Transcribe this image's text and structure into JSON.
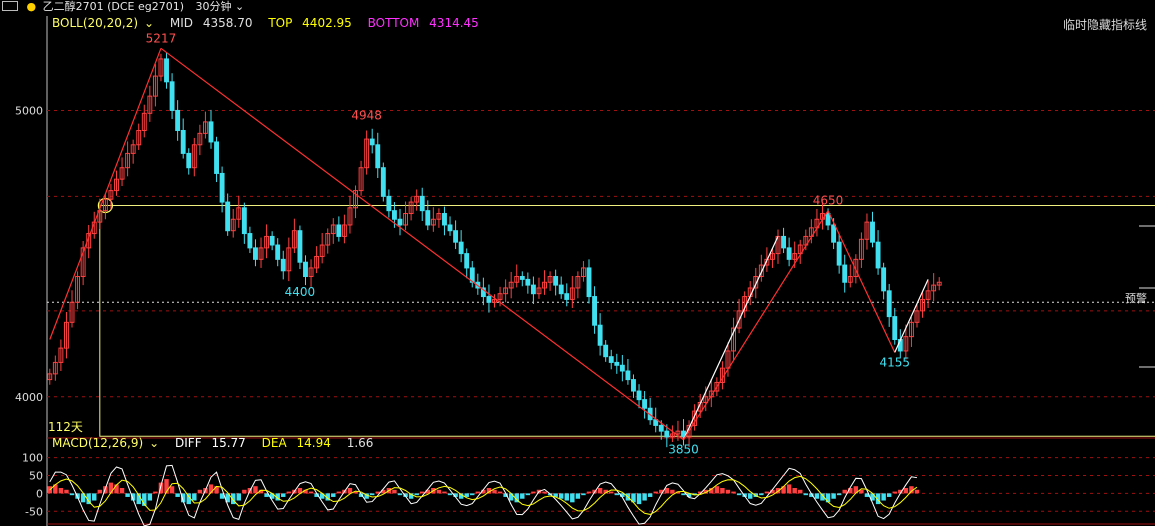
{
  "window": {
    "name": "乙二醇2701 (DCE eg2701)",
    "period": "30分钟"
  },
  "boll": {
    "label": "BOLL(20,20,2)",
    "mid_label": "MID",
    "mid": "4358.70",
    "top_label": "TOP",
    "top": "4402.95",
    "bottom_label": "BOTTOM",
    "bottom": "4314.45"
  },
  "hide_button": "临时隐藏指标线",
  "alert_label": "预警",
  "range_label": "112天",
  "macd": {
    "label": "MACD(12,26,9)",
    "diff_label": "DIFF",
    "diff": "15.77",
    "dea_label": "DEA",
    "dea": "14.94",
    "macd": "1.66"
  },
  "colors": {
    "up": "#ff4040",
    "down": "#40e0f0",
    "diff_line": "#ffffff",
    "dea_line": "#ffff00",
    "grid": "#a01010",
    "axis": "#c0c0c0"
  },
  "chart_data": {
    "type": "candlestick",
    "price_axis": {
      "ylim": [
        3870,
        5260
      ],
      "ticks": [
        "5000",
        "4000"
      ]
    },
    "macd_axis": {
      "ylim": [
        -80,
        110
      ],
      "ticks": [
        "100",
        "50",
        "0",
        "-50"
      ]
    },
    "annotations": [
      {
        "label": "5217",
        "index": 20,
        "price": 5217,
        "kind": "high"
      },
      {
        "label": "4948",
        "index": 57,
        "price": 4948,
        "kind": "high"
      },
      {
        "label": "4400",
        "index": 45,
        "price": 4400,
        "kind": "low"
      },
      {
        "label": "3850",
        "index": 114,
        "price": 3850,
        "kind": "low"
      },
      {
        "label": "4650",
        "index": 140,
        "price": 4650,
        "kind": "high"
      },
      {
        "label": "4155",
        "index": 152,
        "price": 4155,
        "kind": "low"
      }
    ],
    "alert_price": 4330,
    "box": {
      "top_price": 4668,
      "bottom_price": 3862,
      "from_index": 9
    },
    "trend_lines": [
      {
        "from": [
          0,
          4200
        ],
        "to": [
          20,
          5217
        ],
        "color": "#ff3030"
      },
      {
        "from": [
          20,
          5217
        ],
        "to": [
          114,
          3850
        ],
        "color": "#ff3030"
      },
      {
        "from": [
          114,
          3850
        ],
        "to": [
          131,
          4560
        ],
        "color": "#ffffff"
      },
      {
        "from": [
          114,
          3850
        ],
        "to": [
          140,
          4650
        ],
        "color": "#ff3030"
      },
      {
        "from": [
          140,
          4650
        ],
        "to": [
          152,
          4155
        ],
        "color": "#ff3030"
      },
      {
        "from": [
          152,
          4155
        ],
        "to": [
          158,
          4410
        ],
        "color": "#ffffff"
      }
    ],
    "closes": [
      4080,
      4120,
      4170,
      4260,
      4330,
      4420,
      4520,
      4570,
      4610,
      4650,
      4690,
      4720,
      4760,
      4800,
      4850,
      4880,
      4930,
      4990,
      5050,
      5120,
      5180,
      5100,
      5000,
      4930,
      4850,
      4800,
      4880,
      4920,
      4960,
      4890,
      4780,
      4680,
      4580,
      4620,
      4660,
      4570,
      4520,
      4480,
      4520,
      4560,
      4530,
      4480,
      4440,
      4520,
      4580,
      4470,
      4420,
      4450,
      4490,
      4530,
      4570,
      4600,
      4560,
      4600,
      4660,
      4720,
      4800,
      4900,
      4880,
      4800,
      4700,
      4650,
      4620,
      4600,
      4640,
      4680,
      4700,
      4650,
      4600,
      4620,
      4640,
      4600,
      4580,
      4540,
      4500,
      4450,
      4400,
      4380,
      4350,
      4330,
      4340,
      4360,
      4380,
      4400,
      4420,
      4410,
      4390,
      4360,
      4380,
      4400,
      4420,
      4390,
      4360,
      4340,
      4380,
      4420,
      4450,
      4350,
      4250,
      4180,
      4140,
      4120,
      4110,
      4090,
      4060,
      4020,
      3990,
      3960,
      3920,
      3900,
      3880,
      3860,
      3870,
      3880,
      3860,
      3900,
      3950,
      3980,
      4000,
      4020,
      4050,
      4100,
      4160,
      4240,
      4300,
      4350,
      4380,
      4420,
      4460,
      4480,
      4500,
      4560,
      4520,
      4480,
      4500,
      4530,
      4560,
      4590,
      4620,
      4640,
      4600,
      4540,
      4460,
      4400,
      4420,
      4480,
      4550,
      4610,
      4540,
      4450,
      4370,
      4280,
      4200,
      4160,
      4210,
      4260,
      4300,
      4340,
      4370,
      4390,
      4400
    ],
    "macd_hist": [
      20,
      25,
      15,
      10,
      -5,
      -15,
      -25,
      -30,
      -20,
      10,
      20,
      30,
      25,
      15,
      -10,
      -20,
      -30,
      -35,
      -20,
      5,
      30,
      40,
      20,
      -10,
      -25,
      -30,
      -20,
      10,
      15,
      25,
      20,
      -15,
      -25,
      -30,
      -20,
      10,
      15,
      20,
      10,
      -10,
      -15,
      -20,
      -10,
      5,
      10,
      15,
      10,
      5,
      -10,
      -15,
      -20,
      -10,
      5,
      10,
      15,
      5,
      -10,
      -15,
      -5,
      5,
      10,
      15,
      10,
      -5,
      -10,
      -15,
      -5,
      5,
      10,
      15,
      10,
      5,
      -5,
      -10,
      -15,
      -10,
      -5,
      5,
      10,
      15,
      10,
      5,
      -10,
      -20,
      -25,
      -15,
      -5,
      5,
      10,
      5,
      -5,
      -10,
      -15,
      -20,
      -25,
      -15,
      -5,
      5,
      10,
      15,
      10,
      5,
      -5,
      -10,
      -20,
      -25,
      -30,
      -20,
      -10,
      5,
      10,
      15,
      10,
      5,
      -5,
      -10,
      -5,
      5,
      10,
      15,
      20,
      15,
      10,
      5,
      -5,
      -10,
      -15,
      -10,
      -5,
      5,
      10,
      15,
      20,
      25,
      15,
      10,
      -5,
      -10,
      -15,
      -20,
      -25,
      -15,
      -5,
      10,
      15,
      20,
      10,
      -10,
      -20,
      -30,
      -20,
      -10,
      5,
      10,
      15,
      20,
      10
    ]
  }
}
